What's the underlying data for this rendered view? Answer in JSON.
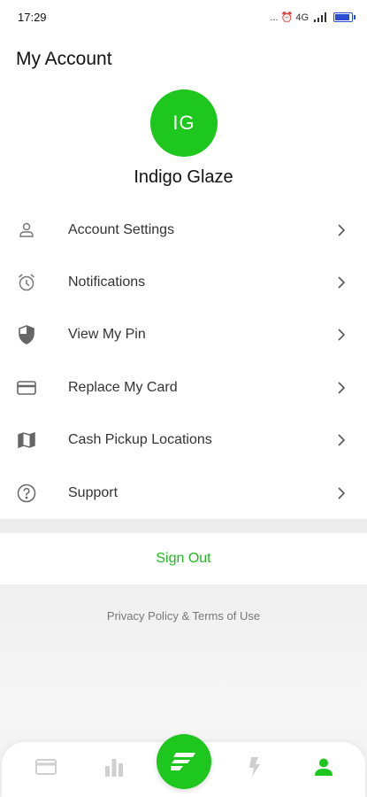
{
  "status_bar": {
    "time": "17:29",
    "indicators": "... ⏰ 4G"
  },
  "page": {
    "title": "My Account"
  },
  "profile": {
    "initials": "IG",
    "name": "Indigo Glaze",
    "avatar_color": "#1ec71e"
  },
  "menu": {
    "items": [
      {
        "label": "Account Settings",
        "icon": "person-icon"
      },
      {
        "label": "Notifications",
        "icon": "alarm-clock-icon"
      },
      {
        "label": "View My Pin",
        "icon": "shield-icon"
      },
      {
        "label": "Replace My Card",
        "icon": "card-icon"
      },
      {
        "label": "Cash Pickup Locations",
        "icon": "map-icon"
      },
      {
        "label": "Support",
        "icon": "help-circle-icon"
      }
    ]
  },
  "actions": {
    "sign_out": "Sign Out",
    "sign_out_color": "#21b921"
  },
  "footer": {
    "legal": "Privacy Policy & Terms of Use"
  },
  "bottom_nav": {
    "items": [
      {
        "icon": "card-icon",
        "active": false
      },
      {
        "icon": "bar-chart-icon",
        "active": false
      },
      {
        "icon": "brand-logo-icon",
        "active": true
      },
      {
        "icon": "lightning-icon",
        "active": false
      },
      {
        "icon": "profile-icon",
        "active": true
      }
    ],
    "active_color": "#1ec71e",
    "inactive_color": "#cfcfcf"
  }
}
